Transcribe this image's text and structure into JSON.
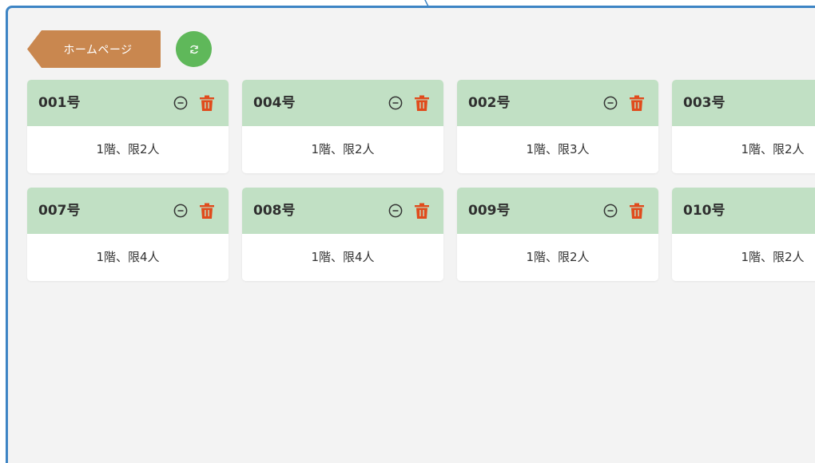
{
  "toolbar": {
    "home_label": "ホームページ",
    "home_color": "#c9874f",
    "refresh_icon": "refresh-icon",
    "refresh_color": "#5fb85a"
  },
  "colors": {
    "frame_border": "#3d84c4",
    "card_header": "#c1e0c4",
    "trash": "#e04b1c"
  },
  "rooms": [
    {
      "name": "001号",
      "info": "1階、限2人"
    },
    {
      "name": "004号",
      "info": "1階、限2人"
    },
    {
      "name": "002号",
      "info": "1階、限3人"
    },
    {
      "name": "003号",
      "info": "1階、限2人"
    },
    {
      "name": "007号",
      "info": "1階、限4人"
    },
    {
      "name": "008号",
      "info": "1階、限4人"
    },
    {
      "name": "009号",
      "info": "1階、限2人"
    },
    {
      "name": "010号",
      "info": "1階、限2人"
    }
  ]
}
